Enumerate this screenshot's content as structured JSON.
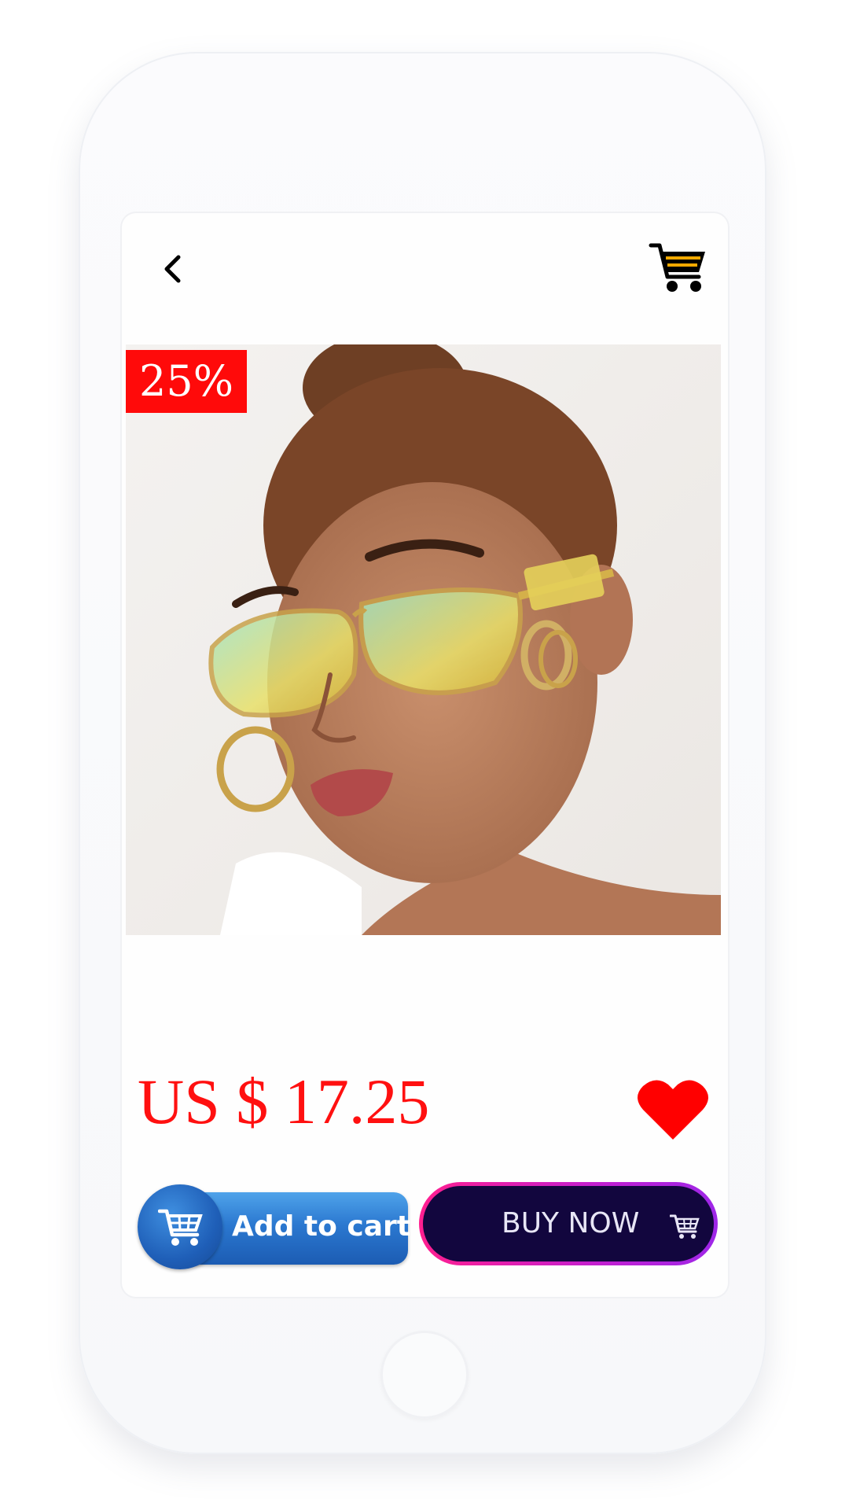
{
  "product": {
    "discount_badge": "25%",
    "price": "US $ 17.25",
    "image_alt": "product photo: woman wearing yellow-tinted metal-frame sunglasses"
  },
  "actions": {
    "add_to_cart_label": "Add to cart",
    "buy_now_label": "BUY NOW"
  },
  "icons": {
    "back": "chevron-left-icon",
    "cart": "shopping-cart-icon",
    "favorite": "heart-icon"
  },
  "colors": {
    "price": "#ff1010",
    "badge": "#ff0a0a",
    "heart": "#ff0000",
    "add_to_cart": "#2b78d0",
    "buy_now_bg": "#12063e",
    "buy_now_border": "#ff1f8f"
  }
}
